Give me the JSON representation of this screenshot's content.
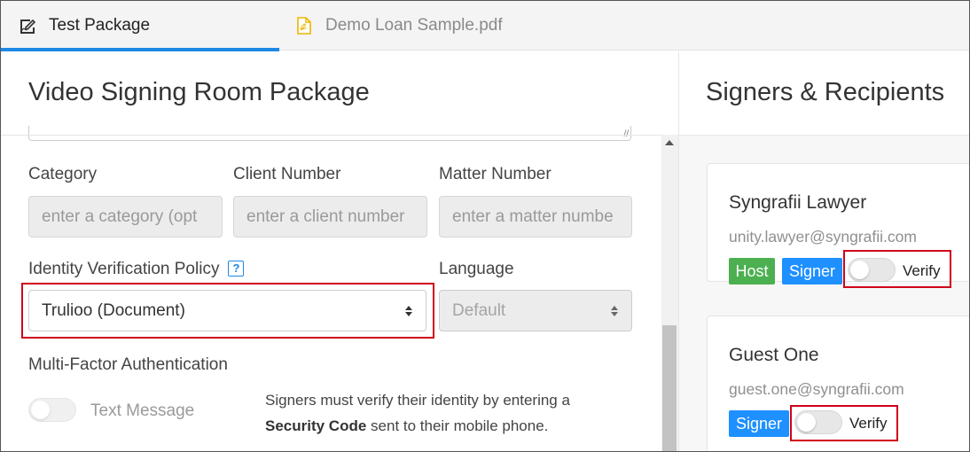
{
  "tabs": [
    {
      "label": "Test Package",
      "icon": "signature-edit-icon",
      "active": true
    },
    {
      "label": "Demo Loan Sample.pdf",
      "icon": "pdf-file-icon",
      "active": false
    }
  ],
  "left": {
    "title": "Video Signing Room Package",
    "fields": {
      "category": {
        "label": "Category",
        "placeholder": "enter a category (opt"
      },
      "client_number": {
        "label": "Client Number",
        "placeholder": "enter a client number"
      },
      "matter_number": {
        "label": "Matter Number",
        "placeholder": "enter a matter numbe"
      }
    },
    "identity_policy": {
      "label": "Identity Verification Policy",
      "help": "?",
      "value": "Trulioo (Document)"
    },
    "language": {
      "label": "Language",
      "value": "Default"
    },
    "mfa": {
      "label": "Multi-Factor Authentication",
      "toggle_label": "Text Message",
      "desc_pre": "Signers must verify their identity by entering a",
      "desc_bold": "Security Code",
      "desc_post": " sent to their mobile phone."
    }
  },
  "right": {
    "title": "Signers & Recipients",
    "signers": [
      {
        "name": "Syngrafii Lawyer",
        "email": "unity.lawyer@syngrafii.com",
        "badges": [
          "Host",
          "Signer"
        ],
        "verify_label": "Verify"
      },
      {
        "name": "Guest One",
        "email": "guest.one@syngrafii.com",
        "badges": [
          "Signer"
        ],
        "verify_label": "Verify"
      }
    ]
  },
  "colors": {
    "accent": "#1e88e5",
    "host_badge": "#4caf50",
    "signer_badge": "#1e90ff",
    "highlight": "#d0021b"
  }
}
